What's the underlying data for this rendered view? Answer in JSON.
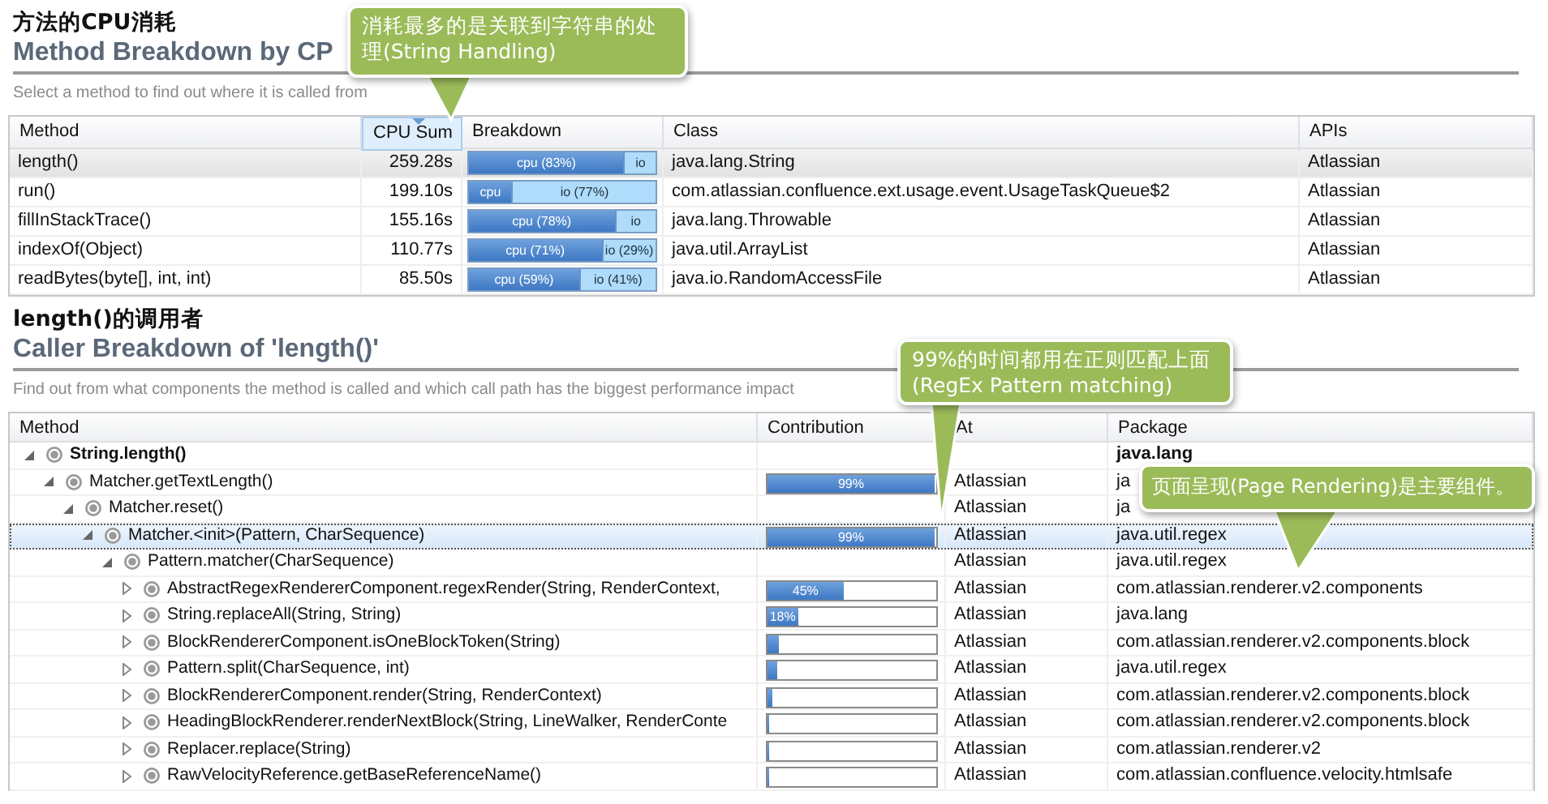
{
  "section_1": {
    "title_zh": "方法的CPU消耗",
    "title": "Method Breakdown by CP",
    "subtitle": "Select a method to find out where it is called from"
  },
  "method_table": {
    "columns": [
      {
        "label": "Method",
        "sorted": false
      },
      {
        "label": "CPU Sum",
        "sorted": true
      },
      {
        "label": "Breakdown",
        "sorted": false
      },
      {
        "label": "Class",
        "sorted": false
      },
      {
        "label": "APIs",
        "sorted": false
      }
    ],
    "rows": [
      {
        "method": "length()",
        "cpu_sum": "259.28s",
        "breakdown": {
          "level": 0.83,
          "cpu_label": "cpu (83%)",
          "io_label": "io"
        },
        "class": "java.lang.String",
        "apis": "Atlassian",
        "selected": true
      },
      {
        "method": "run()",
        "cpu_sum": "199.10s",
        "breakdown": {
          "level": 0.23,
          "cpu_label": "cpu",
          "io_label": "io (77%)"
        },
        "class": "com.atlassian.confluence.ext.usage.event.UsageTaskQueue$2",
        "apis": "Atlassian",
        "selected": false
      },
      {
        "method": "fillInStackTrace()",
        "cpu_sum": "155.16s",
        "breakdown": {
          "level": 0.78,
          "cpu_label": "cpu (78%)",
          "io_label": "io"
        },
        "class": "java.lang.Throwable",
        "apis": "Atlassian",
        "selected": false
      },
      {
        "method": "indexOf(Object)",
        "cpu_sum": "110.77s",
        "breakdown": {
          "level": 0.71,
          "cpu_label": "cpu (71%)",
          "io_label": "io (29%)"
        },
        "class": "java.util.ArrayList",
        "apis": "Atlassian",
        "selected": false
      },
      {
        "method": "readBytes(byte[], int, int)",
        "cpu_sum": "85.50s",
        "breakdown": {
          "level": 0.59,
          "cpu_label": "cpu (59%)",
          "io_label": "io (41%)"
        },
        "class": "java.io.RandomAccessFile",
        "apis": "Atlassian",
        "selected": false
      }
    ]
  },
  "section_2": {
    "title_zh": "length()的调用者",
    "title": "Caller Breakdown of 'length()'",
    "subtitle": "Find out from what components the method is called and which call path has the biggest performance impact"
  },
  "caller_table": {
    "columns": [
      {
        "label": "Method"
      },
      {
        "label": "Contribution"
      },
      {
        "label": "At"
      },
      {
        "label": "Package"
      }
    ],
    "rows": [
      {
        "method": "String.length()",
        "package": "java.lang",
        "selected": false,
        "expanded": true,
        "children": [
          {
            "method": "Matcher.getTextLength()",
            "api": "Atlassian",
            "package": "ja",
            "contribution": {
              "level": 0.99,
              "label": "99%"
            },
            "selected": false,
            "expanded": true,
            "children": [
              {
                "method": "Matcher.reset()",
                "api": "Atlassian",
                "package": "ja",
                "selected": false,
                "expanded": true,
                "children": [
                  {
                    "method": "Matcher.<init>(Pattern, CharSequence)",
                    "api": "Atlassian",
                    "package": "java.util.regex",
                    "contribution": {
                      "level": 0.99,
                      "label": "99%"
                    },
                    "selected": true,
                    "expanded": true,
                    "children": [
                      {
                        "method": "Pattern.matcher(CharSequence)",
                        "api": "Atlassian",
                        "package": "java.util.regex",
                        "selected": false,
                        "expanded": true,
                        "children": [
                          {
                            "method": "AbstractRegexRendererComponent.regexRender(String, RenderContext,",
                            "api": "Atlassian",
                            "package": "com.atlassian.renderer.v2.components",
                            "contribution": {
                              "level": 0.45,
                              "label": "45%"
                            },
                            "selected": false,
                            "expanded": false
                          },
                          {
                            "method": "String.replaceAll(String, String)",
                            "api": "Atlassian",
                            "package": "java.lang",
                            "contribution": {
                              "level": 0.18,
                              "label": "18%"
                            },
                            "selected": false,
                            "expanded": false
                          },
                          {
                            "method": "BlockRendererComponent.isOneBlockToken(String)",
                            "api": "Atlassian",
                            "package": "com.atlassian.renderer.v2.components.block",
                            "contribution": {
                              "level": 0.07
                            },
                            "selected": false,
                            "expanded": false
                          },
                          {
                            "method": "Pattern.split(CharSequence, int)",
                            "api": "Atlassian",
                            "package": "java.util.regex",
                            "contribution": {
                              "level": 0.06
                            },
                            "selected": false,
                            "expanded": false
                          },
                          {
                            "method": "BlockRendererComponent.render(String, RenderContext)",
                            "api": "Atlassian",
                            "package": "com.atlassian.renderer.v2.components.block",
                            "contribution": {
                              "level": 0.03
                            },
                            "selected": false,
                            "expanded": false
                          },
                          {
                            "method": "HeadingBlockRenderer.renderNextBlock(String, LineWalker, RenderConte",
                            "api": "Atlassian",
                            "package": "com.atlassian.renderer.v2.components.block",
                            "contribution": {
                              "level": 0.01
                            },
                            "selected": false,
                            "expanded": false
                          },
                          {
                            "method": "Replacer.replace(String)",
                            "api": "Atlassian",
                            "package": "com.atlassian.renderer.v2",
                            "contribution": {
                              "level": 0.01
                            },
                            "selected": false,
                            "expanded": false
                          },
                          {
                            "method": "RawVelocityReference.getBaseReferenceName()",
                            "api": "Atlassian",
                            "package": "com.atlassian.confluence.velocity.htmlsafe",
                            "contribution": {
                              "level": 0.01
                            },
                            "selected": false,
                            "expanded": false
                          }
                        ]
                      }
                    ]
                  }
                ]
              }
            ]
          }
        ]
      }
    ]
  },
  "callouts": [
    {
      "text": "消耗最多的是关联到字符串的处理(String Handling)"
    },
    {
      "text": "99%的时间都用在正则匹配上面(RegEx Pattern matching)"
    },
    {
      "text": "页面呈现(Page Rendering)是主要组件。"
    }
  ]
}
